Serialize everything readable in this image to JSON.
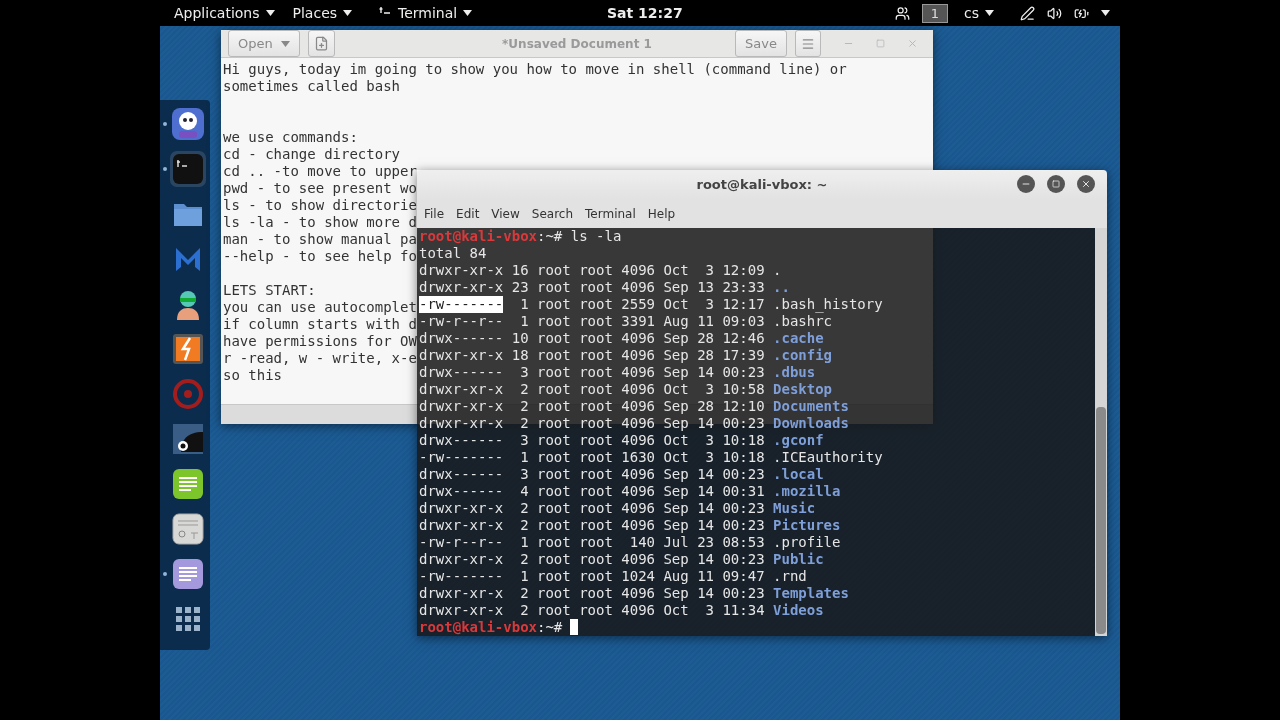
{
  "top_bar": {
    "menus": [
      {
        "label": "Applications",
        "kind": "plain"
      },
      {
        "label": "Places",
        "kind": "plain"
      },
      {
        "label": "Terminal",
        "kind": "terminal"
      }
    ],
    "clock": "Sat 12:27",
    "workspace": "1",
    "keyboard_layout": "cs"
  },
  "dock": [
    {
      "kind": "bot",
      "running": true
    },
    {
      "kind": "terminal",
      "running": true
    },
    {
      "kind": "folder",
      "running": false
    },
    {
      "kind": "letter-m",
      "running": false
    },
    {
      "kind": "person",
      "running": false
    },
    {
      "kind": "lightning",
      "running": false
    },
    {
      "kind": "red-circle",
      "running": false
    },
    {
      "kind": "creature",
      "running": false
    },
    {
      "kind": "green-notes",
      "running": false
    },
    {
      "kind": "keypad",
      "running": false
    },
    {
      "kind": "purple-notes",
      "running": true
    },
    {
      "kind": "grid",
      "running": false
    }
  ],
  "editor": {
    "open_button": "Open",
    "title": "*Unsaved Document 1",
    "save_button": "Save",
    "paragraphs": [
      {
        "kind": "double",
        "lines": [
          "Hi guys, today im going to show you how to move in shell (command line) or",
          "sometimes called bash"
        ]
      },
      {
        "kind": "single",
        "lines": [
          "we use commands:",
          "cd - change directory",
          "cd .. -to move to upper",
          "pwd - to see present wo",
          "ls - to show directorie",
          "ls -la - to show more d",
          "man - to show manual pa",
          "--help - to see help fo"
        ]
      },
      {
        "kind": "single",
        "lines": [
          "LETS START:",
          "you can use autocomplet",
          "if column starts with d",
          "have permissions for OW",
          "r -read, w - write, x-e",
          "so this"
        ]
      }
    ]
  },
  "terminal": {
    "title": "root@kali-vbox: ~",
    "menu": [
      "File",
      "Edit",
      "View",
      "Search",
      "Terminal",
      "Help"
    ],
    "lines": [
      {
        "kind": "prompt",
        "user_host": "root@kali-vbox",
        "path": ":~#",
        "command": "ls -la",
        "cursor": false
      },
      {
        "kind": "text",
        "text": "total 84"
      },
      {
        "kind": "entry",
        "perms": "drwxr-xr-x",
        "details": "16 root root 4096 Oct  3 12:09",
        "name": ".",
        "directory": false,
        "selected": false
      },
      {
        "kind": "entry",
        "perms": "drwxr-xr-x",
        "details": "23 root root 4096 Sep 13 23:33",
        "name": "..",
        "directory": true,
        "selected": false
      },
      {
        "kind": "entry",
        "perms": "-rw-------",
        "details": " 1 root root 2559 Oct  3 12:17",
        "name": ".bash_history",
        "directory": false,
        "selected": true
      },
      {
        "kind": "entry",
        "perms": "-rw-r--r--",
        "details": " 1 root root 3391 Aug 11 09:03",
        "name": ".bashrc",
        "directory": false,
        "selected": false
      },
      {
        "kind": "entry",
        "perms": "drwx------",
        "details": "10 root root 4096 Sep 28 12:46",
        "name": ".cache",
        "directory": true,
        "selected": false
      },
      {
        "kind": "entry",
        "perms": "drwxr-xr-x",
        "details": "18 root root 4096 Sep 28 17:39",
        "name": ".config",
        "directory": true,
        "selected": false
      },
      {
        "kind": "entry",
        "perms": "drwx------",
        "details": " 3 root root 4096 Sep 14 00:23",
        "name": ".dbus",
        "directory": true,
        "selected": false
      },
      {
        "kind": "entry",
        "perms": "drwxr-xr-x",
        "details": " 2 root root 4096 Oct  3 10:58",
        "name": "Desktop",
        "directory": true,
        "selected": false
      },
      {
        "kind": "entry",
        "perms": "drwxr-xr-x",
        "details": " 2 root root 4096 Sep 28 12:10",
        "name": "Documents",
        "directory": true,
        "selected": false
      },
      {
        "kind": "entry",
        "perms": "drwxr-xr-x",
        "details": " 2 root root 4096 Sep 14 00:23",
        "name": "Downloads",
        "directory": true,
        "selected": false
      },
      {
        "kind": "entry",
        "perms": "drwx------",
        "details": " 3 root root 4096 Oct  3 10:18",
        "name": ".gconf",
        "directory": true,
        "selected": false
      },
      {
        "kind": "entry",
        "perms": "-rw-------",
        "details": " 1 root root 1630 Oct  3 10:18",
        "name": ".ICEauthority",
        "directory": false,
        "selected": false
      },
      {
        "kind": "entry",
        "perms": "drwx------",
        "details": " 3 root root 4096 Sep 14 00:23",
        "name": ".local",
        "directory": true,
        "selected": false
      },
      {
        "kind": "entry",
        "perms": "drwx------",
        "details": " 4 root root 4096 Sep 14 00:31",
        "name": ".mozilla",
        "directory": true,
        "selected": false
      },
      {
        "kind": "entry",
        "perms": "drwxr-xr-x",
        "details": " 2 root root 4096 Sep 14 00:23",
        "name": "Music",
        "directory": true,
        "selected": false
      },
      {
        "kind": "entry",
        "perms": "drwxr-xr-x",
        "details": " 2 root root 4096 Sep 14 00:23",
        "name": "Pictures",
        "directory": true,
        "selected": false
      },
      {
        "kind": "entry",
        "perms": "-rw-r--r--",
        "details": " 1 root root  140 Jul 23 08:53",
        "name": ".profile",
        "directory": false,
        "selected": false
      },
      {
        "kind": "entry",
        "perms": "drwxr-xr-x",
        "details": " 2 root root 4096 Sep 14 00:23",
        "name": "Public",
        "directory": true,
        "selected": false
      },
      {
        "kind": "entry",
        "perms": "-rw-------",
        "details": " 1 root root 1024 Aug 11 09:47",
        "name": ".rnd",
        "directory": false,
        "selected": false
      },
      {
        "kind": "entry",
        "perms": "drwxr-xr-x",
        "details": " 2 root root 4096 Sep 14 00:23",
        "name": "Templates",
        "directory": true,
        "selected": false
      },
      {
        "kind": "entry",
        "perms": "drwxr-xr-x",
        "details": " 2 root root 4096 Oct  3 11:34",
        "name": "Videos",
        "directory": true,
        "selected": false
      },
      {
        "kind": "prompt",
        "user_host": "root@kali-vbox",
        "path": ":~#",
        "cursor": true
      }
    ]
  }
}
